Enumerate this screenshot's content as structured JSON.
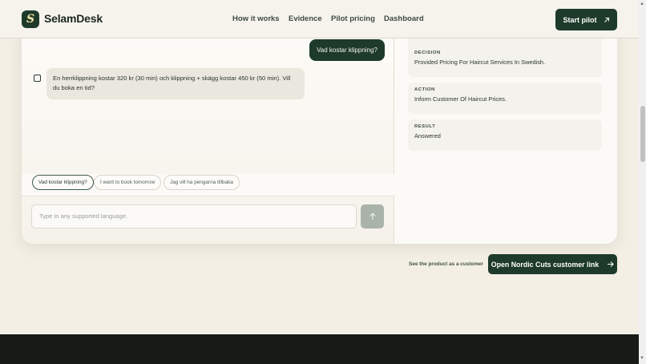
{
  "brand": {
    "logo_letter": "S",
    "name": "SelamDesk"
  },
  "nav": {
    "items": [
      "How it works",
      "Evidence",
      "Pilot pricing",
      "Dashboard"
    ],
    "cta_label": "Start pilot",
    "cta_icon": "arrow-up-right-icon"
  },
  "chat": {
    "user_message": "Vad kostar klippning?",
    "bot_line1": "En herrklippning kostar 320 kr (30 min) och klippning + skägg kostar 450 kr (50 min). Vill",
    "bot_line2": "du boka en tid?",
    "suggestions": [
      "Vad kostar klippning?",
      "I want to book tomorrow",
      "Jag vill ha pengarna tillbaka"
    ],
    "input_placeholder": "Type in any supported language.",
    "send_icon": "arrow-up-icon"
  },
  "log": [
    {
      "label": "DECISION",
      "value": "Provided Pricing For Haircut Services In Swedish."
    },
    {
      "label": "ACTION",
      "value": "Inform Customer Of Haircut Prices."
    },
    {
      "label": "RESULT",
      "value": "Answered"
    }
  ],
  "below_card": {
    "caption": "See the product as a customer",
    "link_label": "Open Nordic Cuts customer link",
    "link_icon": "arrow-right-icon"
  },
  "colors": {
    "brand_green": "#1e3a2a",
    "page_bg": "#f3efe5",
    "footer_bg": "#171b16"
  }
}
